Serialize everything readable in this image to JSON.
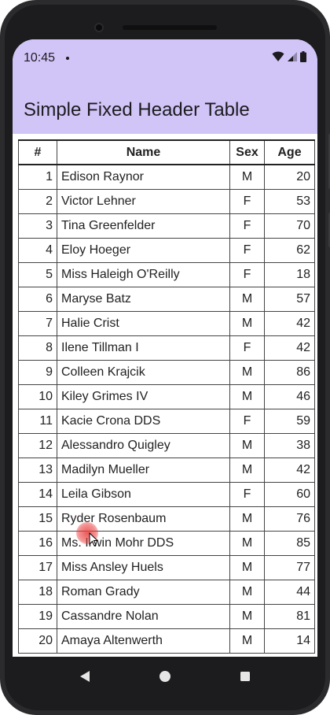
{
  "status_bar": {
    "time": "10:45"
  },
  "app": {
    "title": "Simple Fixed Header Table",
    "header_color": "#d1c4f7"
  },
  "table": {
    "headers": {
      "num": "#",
      "name": "Name",
      "sex": "Sex",
      "age": "Age"
    },
    "rows": [
      {
        "num": "1",
        "name": "Edison Raynor",
        "sex": "M",
        "age": "20"
      },
      {
        "num": "2",
        "name": "Victor Lehner",
        "sex": "F",
        "age": "53"
      },
      {
        "num": "3",
        "name": "Tina Greenfelder",
        "sex": "F",
        "age": "70"
      },
      {
        "num": "4",
        "name": "Eloy Hoeger",
        "sex": "F",
        "age": "62"
      },
      {
        "num": "5",
        "name": "Miss Haleigh O'Reilly",
        "sex": "F",
        "age": "18"
      },
      {
        "num": "6",
        "name": "Maryse Batz",
        "sex": "M",
        "age": "57"
      },
      {
        "num": "7",
        "name": "Halie Crist",
        "sex": "M",
        "age": "42"
      },
      {
        "num": "8",
        "name": "Ilene Tillman I",
        "sex": "F",
        "age": "42"
      },
      {
        "num": "9",
        "name": "Colleen Krajcik",
        "sex": "M",
        "age": "86"
      },
      {
        "num": "10",
        "name": "Kiley Grimes IV",
        "sex": "M",
        "age": "46"
      },
      {
        "num": "11",
        "name": "Kacie Crona DDS",
        "sex": "F",
        "age": "59"
      },
      {
        "num": "12",
        "name": "Alessandro Quigley",
        "sex": "M",
        "age": "38"
      },
      {
        "num": "13",
        "name": "Madilyn Mueller",
        "sex": "M",
        "age": "42"
      },
      {
        "num": "14",
        "name": "Leila Gibson",
        "sex": "F",
        "age": "60"
      },
      {
        "num": "15",
        "name": "Ryder Rosenbaum",
        "sex": "M",
        "age": "76"
      },
      {
        "num": "16",
        "name": "Ms. Irwin Mohr DDS",
        "sex": "M",
        "age": "85"
      },
      {
        "num": "17",
        "name": "Miss Ansley Huels",
        "sex": "M",
        "age": "77"
      },
      {
        "num": "18",
        "name": "Roman Grady",
        "sex": "M",
        "age": "44"
      },
      {
        "num": "19",
        "name": "Cassandre Nolan",
        "sex": "M",
        "age": "81"
      },
      {
        "num": "20",
        "name": "Amaya Altenwerth",
        "sex": "M",
        "age": "14"
      }
    ]
  },
  "nav_bar": {
    "back_icon": "back-triangle-icon",
    "home_icon": "home-circle-icon",
    "recents_icon": "recents-square-icon"
  }
}
